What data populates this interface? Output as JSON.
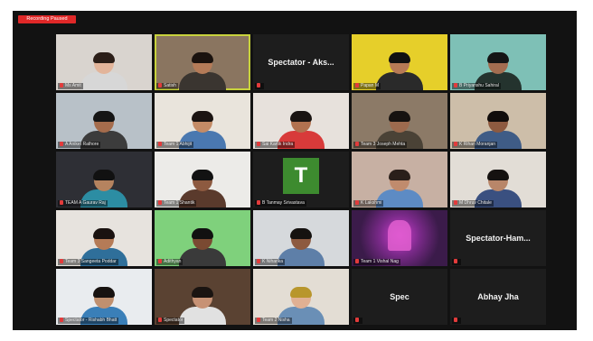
{
  "recording_label": "Recording Paused",
  "tiles": [
    {
      "name": "Ms Amit",
      "type": "video",
      "bg": "#d9d4cf",
      "skin": "#e2b49a",
      "shirt": "#d7d7d7",
      "hair": "#2b1e18"
    },
    {
      "name": "Satish",
      "type": "video",
      "bg": "#8a7560",
      "skin": "#b47b58",
      "shirt": "#3a3530",
      "hair": "#1a120e",
      "active": true
    },
    {
      "name": "",
      "type": "label",
      "label": "Spectator - Aks..."
    },
    {
      "name": "Papan M",
      "type": "video",
      "bg": "#e6cf2a",
      "skin": "#b77a56",
      "shirt": "#2a2a2a",
      "hair": "#111"
    },
    {
      "name": "B Priyanshu Sahiral",
      "type": "video",
      "bg": "#7ec0b6",
      "skin": "#a36d50",
      "shirt": "#24332e",
      "hair": "#151515"
    },
    {
      "name": "A Aniket Rathore",
      "type": "video",
      "bg": "#b8c1c8",
      "skin": "#a56c4c",
      "shirt": "#3c3c3c",
      "hair": "#151515"
    },
    {
      "name": "Team 1 Abhijit",
      "type": "video",
      "bg": "#e9e4dc",
      "skin": "#c48b66",
      "shirt": "#4a78b0",
      "hair": "#1b1412"
    },
    {
      "name": "Sai Kartik Indra",
      "type": "video",
      "bg": "#e7e1dc",
      "skin": "#b27250",
      "shirt": "#d83a3a",
      "hair": "#1a1412"
    },
    {
      "name": "Team 3 Joseph Mehta",
      "type": "video",
      "bg": "#8c7a67",
      "skin": "#9d6a4e",
      "shirt": "#4a4236",
      "hair": "#161210"
    },
    {
      "name": "K Rihan Moranjan",
      "type": "video",
      "bg": "#cdbea9",
      "skin": "#8d5a40",
      "shirt": "#3f5c86",
      "hair": "#100c0b"
    },
    {
      "name": "TEAM A Gaurav Raj",
      "type": "video",
      "bg": "#2e2f35",
      "skin": "#b5835f",
      "shirt": "#2c8da3",
      "hair": "#111"
    },
    {
      "name": "Team 1 Shantik",
      "type": "video",
      "bg": "#ecebe8",
      "skin": "#8d5a40",
      "shirt": "#5a3a2c",
      "hair": "#121212"
    },
    {
      "name": "B Tanmay Srivastava",
      "type": "avatar",
      "letter": "T"
    },
    {
      "name": "K Lakshmi",
      "type": "video",
      "bg": "#c7b0a3",
      "skin": "#c08b6d",
      "shirt": "#5d8bc4",
      "hair": "#2a1f1a"
    },
    {
      "name": "M Dhruv Chitale",
      "type": "video",
      "bg": "#e2ddd6",
      "skin": "#b88669",
      "shirt": "#3a5080",
      "hair": "#151210"
    },
    {
      "name": "Team 3 Sangeeta Poddar",
      "type": "video",
      "bg": "#e7e3de",
      "skin": "#b57b57",
      "shirt": "#2f6f9a",
      "hair": "#1a1210"
    },
    {
      "name": "Adithyan",
      "type": "video",
      "bg": "#7fd17c",
      "skin": "#7a4a32",
      "shirt": "#3a3a3a",
      "hair": "#111"
    },
    {
      "name": "K Niharika",
      "type": "video",
      "bg": "#d6d9dc",
      "skin": "#8d5a40",
      "shirt": "#5e7fa8",
      "hair": "#151210"
    },
    {
      "name": "Team 1 Vishal Nag",
      "type": "image",
      "bg": "#3b1b4a"
    },
    {
      "name": "",
      "type": "label",
      "label": "Spectator-Ham..."
    },
    {
      "name": "Spectator - Rishabh Bhatt",
      "type": "video",
      "bg": "#e9ecef",
      "skin": "#c0906f",
      "shirt": "#3a7fb8",
      "hair": "#171210"
    },
    {
      "name": "Spectator",
      "type": "video",
      "bg": "#5a4232",
      "skin": "#c79275",
      "shirt": "#e1e1e1",
      "hair": "#1a1411"
    },
    {
      "name": "Team 2 Nisha",
      "type": "video",
      "bg": "#e3ddd4",
      "skin": "#e0b093",
      "shirt": "#6a8fb6",
      "hair": "#b8962c"
    },
    {
      "name": "",
      "type": "label",
      "label": "Spec"
    },
    {
      "name": "",
      "type": "label",
      "label": "Abhay Jha"
    }
  ]
}
